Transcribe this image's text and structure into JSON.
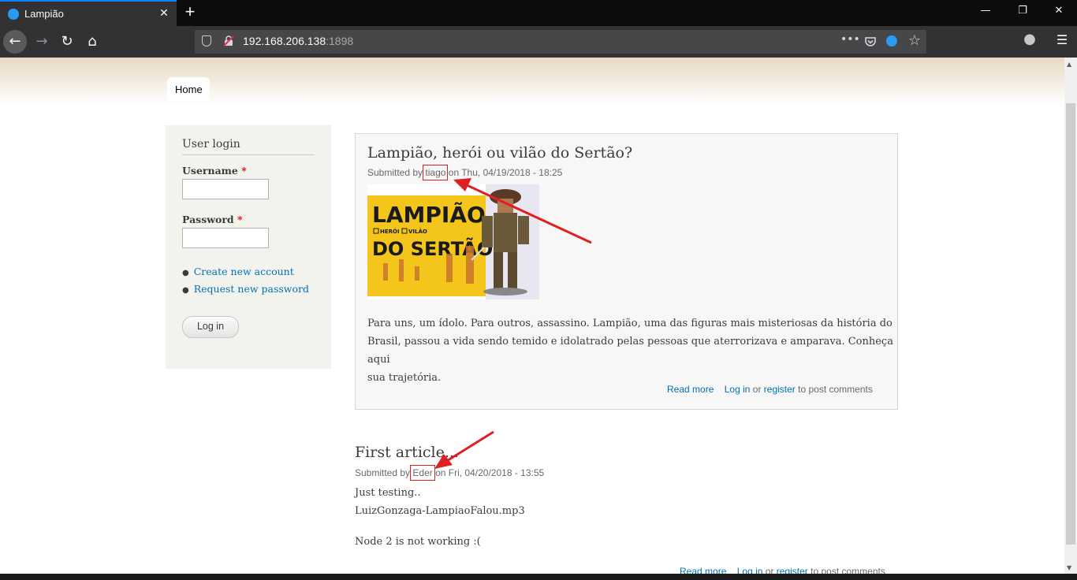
{
  "browser": {
    "tab_title": "Lampião",
    "close_glyph": "✕",
    "new_tab_glyph": "+",
    "url_host": "192.168.206.138",
    "url_port": ":1898",
    "window_controls": {
      "minimize": "—",
      "maximize": "❐",
      "close": "✕"
    },
    "nav": {
      "back": "←",
      "forward": "→",
      "reload": "↻",
      "home": "⌂"
    },
    "url_icons": {
      "more": "•••",
      "pocket": "pocket-icon",
      "extension": "extension-icon",
      "bookmark": "☆"
    },
    "right_icons": {
      "account": "●",
      "menu": "☰"
    },
    "accent": "#0a84ff"
  },
  "site": {
    "nav_home": "Home"
  },
  "login": {
    "title": "User login",
    "username_label": "Username",
    "password_label": "Password",
    "required_mark": "*",
    "links": [
      "Create new account",
      "Request new password"
    ],
    "button": "Log in"
  },
  "node1": {
    "title": "Lampião, herói ou vilão do Sertão?",
    "submitted_prefix": "Submitted by",
    "author": "tiago",
    "date": "on Thu, 04/19/2018 - 18:25",
    "image": {
      "line1": "LAMPIÃO,",
      "opt1": "HERÓI",
      "opt2": "VILÃO",
      "line2": "DO SERTÃO"
    },
    "body": [
      "Para uns, um ídolo. Para outros, assassino. Lampião, uma das figuras mais misteriosas da história do",
      "Brasil, passou a vida sendo temido e idolatrado pelas pessoas que aterrorizava e amparava. Conheça aqui",
      "sua trajetória."
    ],
    "read_more": "Read more",
    "log_in": "Log in",
    "or": "or",
    "register": "register",
    "to_post": "to post comments"
  },
  "node2": {
    "title": "First article...",
    "submitted_prefix": "Submitted by",
    "author": "Eder",
    "date": "on Fri, 04/20/2018 - 13:55",
    "body": [
      "Just testing..",
      "LuizGonzaga-LampiaoFalou.mp3",
      "Node 2 is not working :("
    ],
    "read_more": "Read more",
    "log_in": "Log in",
    "or": "or",
    "register": "register",
    "to_post": "to post comments"
  },
  "annotation_color": "#e02020"
}
